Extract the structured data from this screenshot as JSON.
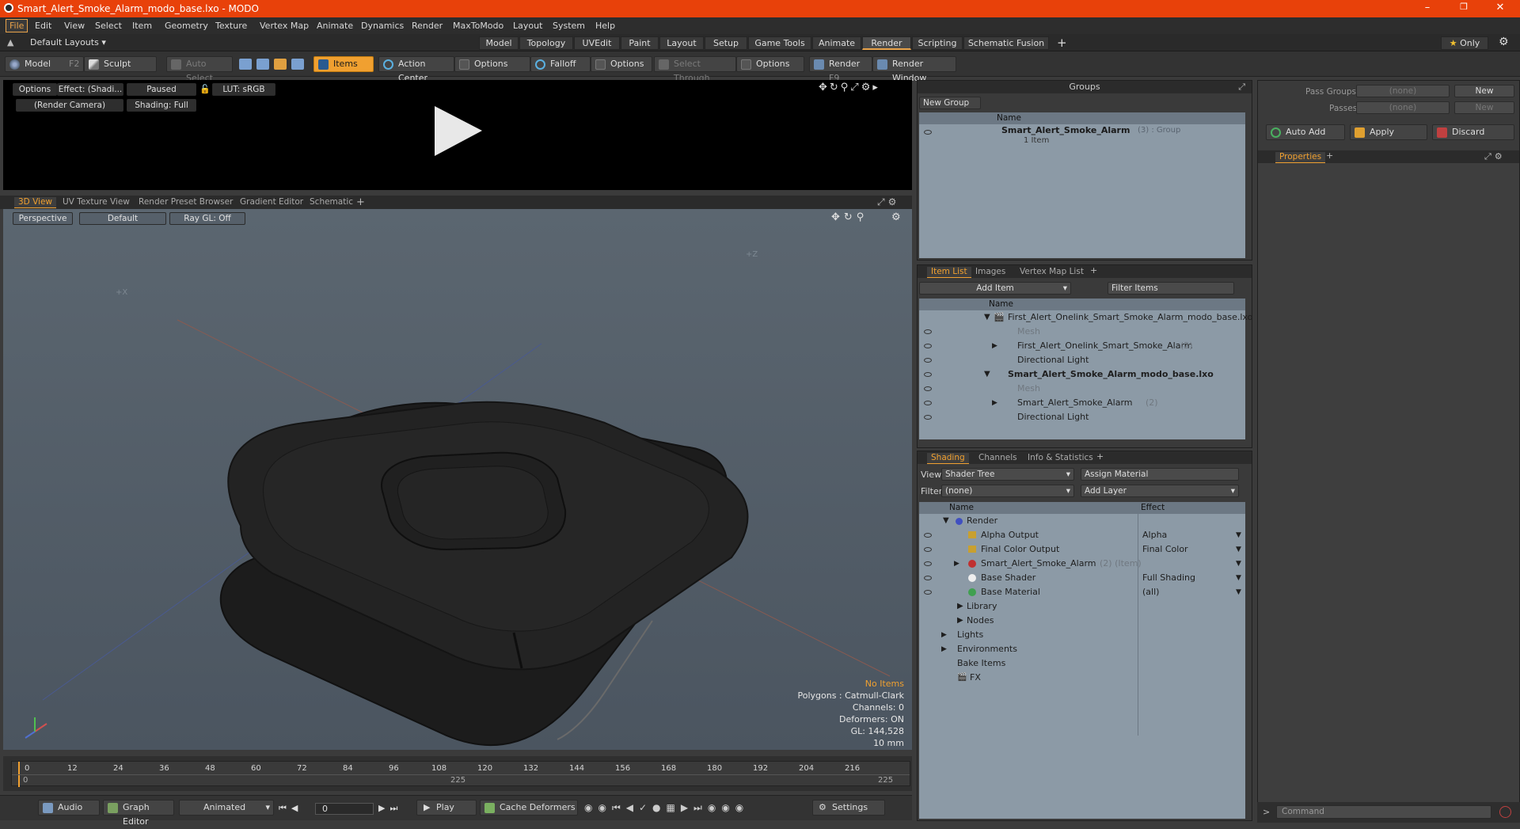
{
  "window": {
    "title": "Smart_Alert_Smoke_Alarm_modo_base.lxo - MODO"
  },
  "menu": [
    "File",
    "Edit",
    "View",
    "Select",
    "Item",
    "Geometry",
    "Texture",
    "Vertex Map",
    "Animate",
    "Dynamics",
    "Render",
    "MaxToModo",
    "Layout",
    "System",
    "Help"
  ],
  "layouts": {
    "label": "Default Layouts"
  },
  "tabs": [
    "Model",
    "Topology",
    "UVEdit",
    "Paint",
    "Layout",
    "Setup",
    "Game Tools",
    "Animate",
    "Render",
    "Scripting",
    "Schematic Fusion"
  ],
  "active_tab": "Render",
  "only_label": "Only",
  "toolbar": {
    "model": "Model",
    "model_key": "F2",
    "sculpt": "Sculpt",
    "auto_select": "Auto Select",
    "items": "Items",
    "action_center": "Action Center",
    "options1": "Options",
    "falloff": "Falloff",
    "options2": "Options",
    "select_through": "Select Through",
    "options3": "Options",
    "render": "Render",
    "render_key": "F9",
    "render_window": "Render Window"
  },
  "render_preview": {
    "options": "Options",
    "effect": "Effect: (Shadi...",
    "paused": "Paused",
    "lut": "LUT: sRGB",
    "camera": "(Render Camera)",
    "shading": "Shading: Full"
  },
  "viewport_tabs": [
    "3D View",
    "UV Texture View",
    "Render Preset Browser",
    "Gradient Editor",
    "Schematic"
  ],
  "viewport": {
    "perspective": "Perspective",
    "default": "Default",
    "raygl": "Ray GL: Off",
    "axis_z": "+Z",
    "axis_x": "+X",
    "info": {
      "no_items": "No Items",
      "polygons": "Polygons : Catmull-Clark",
      "channels": "Channels: 0",
      "deformers": "Deformers: ON",
      "gl": "GL: 144,528",
      "unit": "10 mm"
    }
  },
  "timeline": {
    "ticks": [
      "0",
      "12",
      "24",
      "36",
      "48",
      "60",
      "72",
      "84",
      "96",
      "108",
      "120",
      "132",
      "144",
      "156",
      "168",
      "180",
      "192",
      "204",
      "216"
    ],
    "start": "0",
    "mid": "225",
    "end": "225"
  },
  "bottom": {
    "audio": "Audio",
    "graph_editor": "Graph Editor",
    "animated": "Animated",
    "frame": "0",
    "play": "Play",
    "cache": "Cache Deformers",
    "settings": "Settings"
  },
  "groups": {
    "title": "Groups",
    "new_group": "New Group",
    "col_name": "Name",
    "item_name": "Smart_Alert_Smoke_Alarm",
    "item_suffix": "(3) : Group",
    "item_sub": "1 Item"
  },
  "item_list": {
    "tabs": [
      "Item List",
      "Images",
      "Vertex Map List"
    ],
    "add_item": "Add Item",
    "filter": "Filter Items",
    "col_name": "Name",
    "rows": [
      {
        "label": "First_Alert_Onelink_Smart_Smoke_Alarm_modo_base.lxo",
        "extra": "",
        "bold": false
      },
      {
        "label": "Mesh",
        "extra": "",
        "bold": false
      },
      {
        "label": "First_Alert_Onelink_Smart_Smoke_Alarm",
        "extra": "(2)",
        "bold": false
      },
      {
        "label": "Directional Light",
        "extra": "",
        "bold": false
      },
      {
        "label": "Smart_Alert_Smoke_Alarm_modo_base.lxo",
        "extra": "",
        "bold": true
      },
      {
        "label": "Mesh",
        "extra": "",
        "bold": false
      },
      {
        "label": "Smart_Alert_Smoke_Alarm",
        "extra": "(2)",
        "bold": false
      },
      {
        "label": "Directional Light",
        "extra": "",
        "bold": false
      }
    ]
  },
  "shading": {
    "tabs": [
      "Shading",
      "Channels",
      "Info & Statistics"
    ],
    "view_label": "View",
    "view_value": "Shader Tree",
    "assign": "Assign Material",
    "filter_label": "Filter",
    "filter_value": "(none)",
    "add_layer": "Add Layer",
    "col_name": "Name",
    "col_effect": "Effect",
    "rows": [
      {
        "label": "Render",
        "effect": ""
      },
      {
        "label": "Alpha Output",
        "effect": "Alpha"
      },
      {
        "label": "Final Color Output",
        "effect": "Final Color"
      },
      {
        "label": "Smart_Alert_Smoke_Alarm",
        "extra": "(2) (Item)",
        "effect": ""
      },
      {
        "label": "Base Shader",
        "effect": "Full Shading"
      },
      {
        "label": "Base Material",
        "effect": "(all)"
      },
      {
        "label": "Library",
        "effect": ""
      },
      {
        "label": "Nodes",
        "effect": ""
      },
      {
        "label": "Lights",
        "effect": ""
      },
      {
        "label": "Environments",
        "effect": ""
      },
      {
        "label": "Bake Items",
        "effect": ""
      },
      {
        "label": "FX",
        "effect": ""
      }
    ]
  },
  "pass": {
    "pass_groups": "Pass Groups",
    "passes": "Passes",
    "none1": "(none)",
    "none2": "(none)",
    "new1": "New",
    "new2": "New",
    "auto_add": "Auto Add",
    "apply": "Apply",
    "discard": "Discard",
    "properties": "Properties"
  },
  "command": {
    "placeholder": "Command"
  },
  "colors": {
    "accent": "#f0a030",
    "title_bar": "#e8410a"
  }
}
